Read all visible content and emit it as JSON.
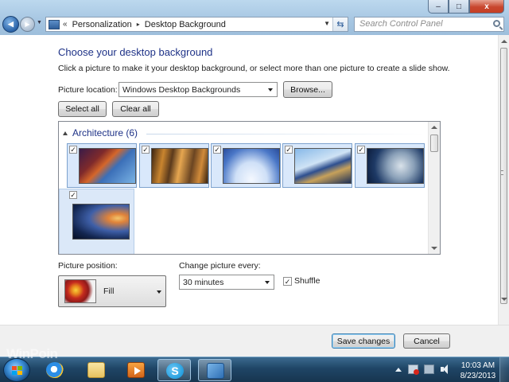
{
  "window": {
    "controls": {
      "minimize": "–",
      "maximize": "□",
      "close": "x"
    }
  },
  "nav": {
    "back": "◀",
    "forward": "▶"
  },
  "address": {
    "chevrons": "«",
    "segments": [
      "Personalization",
      "Desktop Background"
    ],
    "separator": "▸"
  },
  "search": {
    "placeholder": "Search Control Panel"
  },
  "page": {
    "heading": "Choose your desktop background",
    "instructions": "Click a picture to make it your desktop background, or select more than one picture to create a slide show."
  },
  "picture_location": {
    "label": "Picture location:",
    "value": "Windows Desktop Backgrounds",
    "browse": "Browse..."
  },
  "selection": {
    "select_all": "Select all",
    "clear_all": "Clear all"
  },
  "gallery": {
    "group_title": "Architecture (6)",
    "items": [
      {
        "checked": true,
        "check": "✓"
      },
      {
        "checked": true,
        "check": "✓"
      },
      {
        "checked": true,
        "check": "✓"
      },
      {
        "checked": true,
        "check": "✓"
      },
      {
        "checked": true,
        "check": "✓"
      },
      {
        "checked": true,
        "check": "✓"
      }
    ]
  },
  "position": {
    "label": "Picture position:",
    "value": "Fill"
  },
  "interval": {
    "label": "Change picture every:",
    "value": "30 minutes"
  },
  "shuffle": {
    "label": "Shuffle",
    "checked": true,
    "check": "✓"
  },
  "footer": {
    "save": "Save changes",
    "cancel": "Cancel"
  },
  "taskbar": {
    "time": "10:03 AM",
    "date": "8/23/2013",
    "apps": [
      "internet-explorer",
      "windows-explorer",
      "media-player",
      "skype",
      "control-panel"
    ]
  },
  "watermark": "WinPoin"
}
